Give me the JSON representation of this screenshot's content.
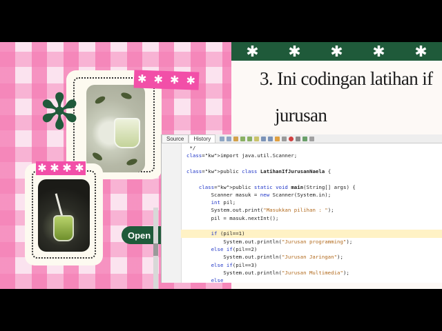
{
  "slide": {
    "title_line1": "3. Ini codingan latihan if",
    "title_line2": "jurusan",
    "open_button": "Open",
    "band_stars": [
      "✱",
      "✱",
      "✱",
      "✱",
      "✱"
    ],
    "tape_top_stars": [
      "✱",
      "✱",
      "✱",
      "✱"
    ],
    "tape_left_stars": [
      "✱",
      "✱",
      "✱",
      "✱"
    ],
    "colors": {
      "accent_green": "#1f5a3a",
      "accent_pink": "#f24fa8"
    }
  },
  "ide": {
    "tabs": [
      "Source",
      "History"
    ],
    "lines": [
      {
        "n": "10",
        "text": " */"
      },
      {
        "n": "11",
        "text": "import java.util.Scanner;"
      },
      {
        "n": "12",
        "text": ""
      },
      {
        "n": "13",
        "text": "public class LatihanIfJurusanNaela {"
      },
      {
        "n": "14",
        "text": ""
      },
      {
        "n": "15",
        "text": "    public static void main(String[] args) {"
      },
      {
        "n": "16",
        "text": "        Scanner masuk = new Scanner(System.in);"
      },
      {
        "n": "17",
        "text": "        int pil;"
      },
      {
        "n": "18",
        "text": "        System.out.print(\"Masukkan pilihan : \");"
      },
      {
        "n": "19",
        "text": "        pil = masuk.nextInt();"
      },
      {
        "n": "20",
        "text": ""
      },
      {
        "n": "21",
        "text": "        if (pil==1)"
      },
      {
        "n": "22",
        "text": "            System.out.println(\"Jurusan programming\");"
      },
      {
        "n": "23",
        "text": "        else if(pil==2)"
      },
      {
        "n": "24",
        "text": "            System.out.println(\"Jurusan Jaringan\");"
      },
      {
        "n": "25",
        "text": "        else if(pil==3)"
      },
      {
        "n": "26",
        "text": "            System.out.println(\"Jurusan Multimedia\");"
      },
      {
        "n": "27",
        "text": "        else"
      }
    ]
  }
}
